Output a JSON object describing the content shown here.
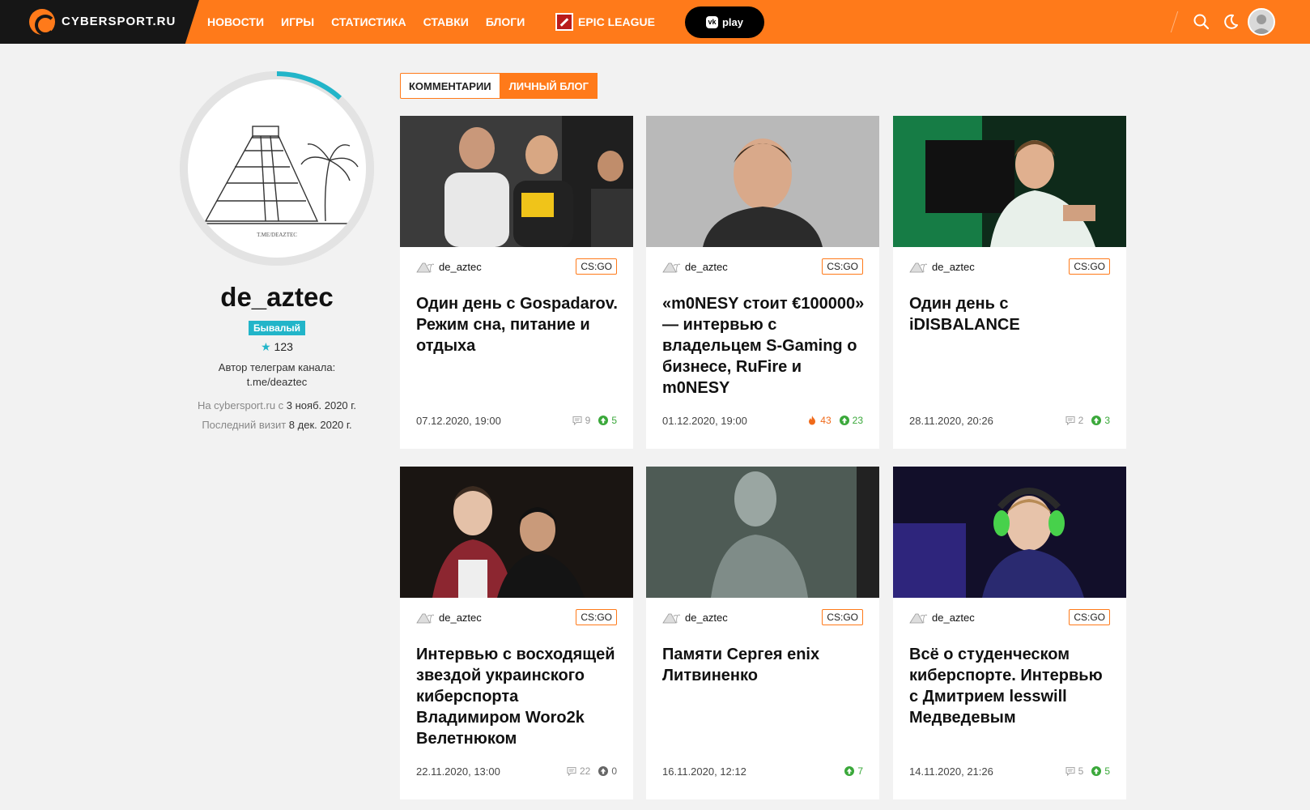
{
  "header": {
    "logo_text": "CYBERSPORT.RU",
    "nav": [
      "НОВОСТИ",
      "ИГРЫ",
      "СТАТИСТИКА",
      "СТАВКИ",
      "БЛОГИ"
    ],
    "epic_label": "EPIC LEAGUE",
    "play_label": "play",
    "vk_label": "vk",
    "accent": "#ff7a1a"
  },
  "profile": {
    "username": "de_aztec",
    "badge": "Бывалый",
    "rating": "123",
    "bio_line1": "Автор телеграм канала:",
    "bio_line2": "t.me/deaztec",
    "joined_label": "На cybersport.ru с",
    "joined_value": "3 нояб. 2020 г.",
    "last_visit_label": "Последний визит",
    "last_visit_value": "8 дек. 2020 г.",
    "avatar_caption": "T.ME/DEAZTEC"
  },
  "tabs": {
    "comments": "КОММЕНТАРИИ",
    "blog": "ЛИЧНЫЙ БЛОГ"
  },
  "cards": [
    {
      "author": "de_aztec",
      "tag": "CS:GO",
      "title": "Один день с Gospadarov. Режим сна, питание и отдыха",
      "date": "07.12.2020, 19:00",
      "comments": "9",
      "likes": "5",
      "hot": ""
    },
    {
      "author": "de_aztec",
      "tag": "CS:GO",
      "title": "«m0NESY стоит €100000» — интервью с владельцем S-Gaming о бизнесе, RuFire и m0NESY",
      "date": "01.12.2020, 19:00",
      "comments": "",
      "likes": "23",
      "hot": "43"
    },
    {
      "author": "de_aztec",
      "tag": "CS:GO",
      "title": "Один день с iDISBALANCE",
      "date": "28.11.2020, 20:26",
      "comments": "2",
      "likes": "3",
      "hot": ""
    },
    {
      "author": "de_aztec",
      "tag": "CS:GO",
      "title": "Интервью с восходящей звездой украинского киберспорта Владимиром Woro2k Велетнюком",
      "date": "22.11.2020, 13:00",
      "comments": "22",
      "likes": "0",
      "hot": ""
    },
    {
      "author": "de_aztec",
      "tag": "CS:GO",
      "title": "Памяти Сергея enix Литвиненко",
      "date": "16.11.2020, 12:12",
      "comments": "",
      "likes": "7",
      "hot": ""
    },
    {
      "author": "de_aztec",
      "tag": "CS:GO",
      "title": "Всё о студенческом киберспорте. Интервью с Дмитрием lesswill Медведевым",
      "date": "14.11.2020, 21:26",
      "comments": "5",
      "likes": "5",
      "hot": ""
    }
  ]
}
